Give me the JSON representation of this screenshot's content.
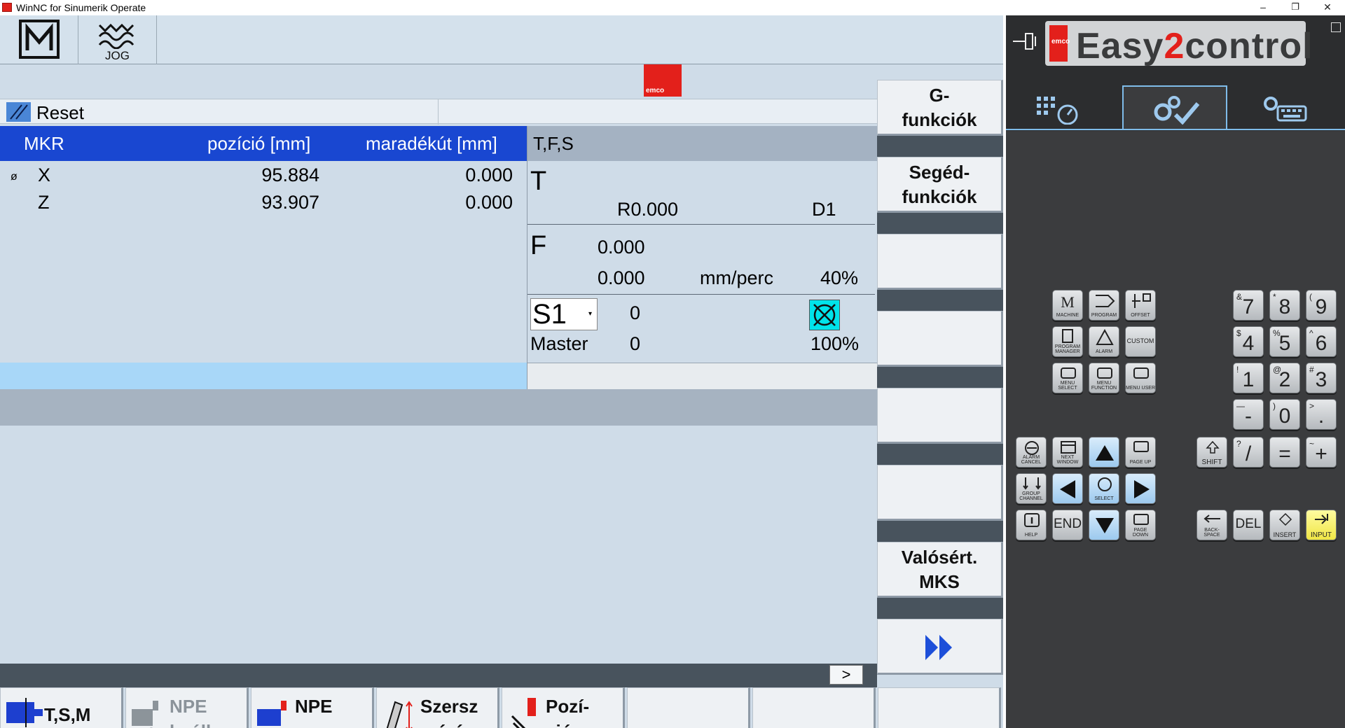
{
  "window": {
    "title": "WinNC for Sinumerik Operate",
    "minimize": "–",
    "restore": "❐",
    "close": "✕"
  },
  "header": {
    "mode_jog_label": "JOG",
    "logo_text": "emco"
  },
  "status": {
    "text": "Reset"
  },
  "axes": {
    "headers": {
      "name": "MKR",
      "position": "pozíció [mm]",
      "remaining": "maradékút [mm]"
    },
    "rows": [
      {
        "symbol": "ø",
        "name": "X",
        "position": "95.884",
        "remaining": "0.000"
      },
      {
        "symbol": "",
        "name": "Z",
        "position": "93.907",
        "remaining": "0.000"
      }
    ]
  },
  "tfs": {
    "title": "T,F,S",
    "t_label": "T",
    "t_radius": "R0.000",
    "t_d": "D1",
    "f_label": "F",
    "f_value": "0.000",
    "f_actual": "0.000",
    "f_unit": "mm/perc",
    "f_override": "40%",
    "s_label": "S1",
    "s_value": "0",
    "master_label": "Master",
    "master_value": "0",
    "s_override": "100%"
  },
  "bottom_strip": {
    "next_label": ">"
  },
  "vertical_softkeys": [
    {
      "line1": "G-",
      "line2": "funkciók"
    },
    {
      "line1": "Segéd-",
      "line2": "funkciók"
    },
    {
      "line1": "",
      "line2": ""
    },
    {
      "line1": "",
      "line2": ""
    },
    {
      "line1": "",
      "line2": ""
    },
    {
      "line1": "",
      "line2": ""
    },
    {
      "line1": "Valósért.",
      "line2": "MKS"
    },
    {
      "line1": "",
      "line2": ""
    }
  ],
  "horizontal_softkeys": [
    {
      "line1": "T,S,M",
      "line2": ""
    },
    {
      "line1": "NPE",
      "line2": "beáll."
    },
    {
      "line1": "NPE",
      "line2": "szersz"
    },
    {
      "line1": "Szersz",
      "line2": "mérés"
    },
    {
      "line1": "Pozí-",
      "line2": "ció"
    }
  ],
  "e2c": {
    "logo_easy": "Easy",
    "logo_two": "2",
    "logo_control": "control",
    "logo_emco": "emco"
  },
  "keypad": {
    "machine": {
      "big": "M",
      "small": "MACHINE"
    },
    "program": {
      "small": "PROGRAM"
    },
    "offset": {
      "small": "OFFSET"
    },
    "program_manager": {
      "small": "PROGRAM MANAGER"
    },
    "alarm": {
      "small": "ALARM"
    },
    "custom": {
      "small": "CUSTOM"
    },
    "menu_select": {
      "small": "MENU SELECT"
    },
    "menu_function": {
      "small": "MENU FUNCTION"
    },
    "menu_user": {
      "small": "MENU USER"
    },
    "alarm_cancel": {
      "small": "ALARM CANCEL"
    },
    "next_window": {
      "small": "NEXT WINDOW"
    },
    "page_up": {
      "small": "PAGE UP"
    },
    "group_channel": {
      "small": "GROUP CHANNEL"
    },
    "select": {
      "small": "SELECT"
    },
    "help": {
      "small": "HELP"
    },
    "end": {
      "big": "END"
    },
    "page_down": {
      "small": "PAGE DOWN"
    },
    "n7": {
      "big": "7",
      "sup": "&"
    },
    "n8": {
      "big": "8",
      "sup": "*"
    },
    "n9": {
      "big": "9",
      "sup": "("
    },
    "n4": {
      "big": "4",
      "sup": "$"
    },
    "n5": {
      "big": "5",
      "sup": "%"
    },
    "n6": {
      "big": "6",
      "sup": "^"
    },
    "n1": {
      "big": "1",
      "sup": "!"
    },
    "n2": {
      "big": "2",
      "sup": "@"
    },
    "n3": {
      "big": "3",
      "sup": "#"
    },
    "minus": {
      "big": "-",
      "sup": "—"
    },
    "n0": {
      "big": "0",
      "sup": ")"
    },
    "dot": {
      "big": ".",
      "sup": ">"
    },
    "shift": {
      "small": "SHIFT"
    },
    "slash": {
      "big": "/",
      "sup": "?"
    },
    "equals": {
      "big": "="
    },
    "plus": {
      "big": "+",
      "sup": "~"
    },
    "backspace": {
      "small": "BACK- SPACE"
    },
    "del": {
      "big": "DEL"
    },
    "insert": {
      "small": "INSERT"
    },
    "input": {
      "small": "INPUT"
    }
  }
}
